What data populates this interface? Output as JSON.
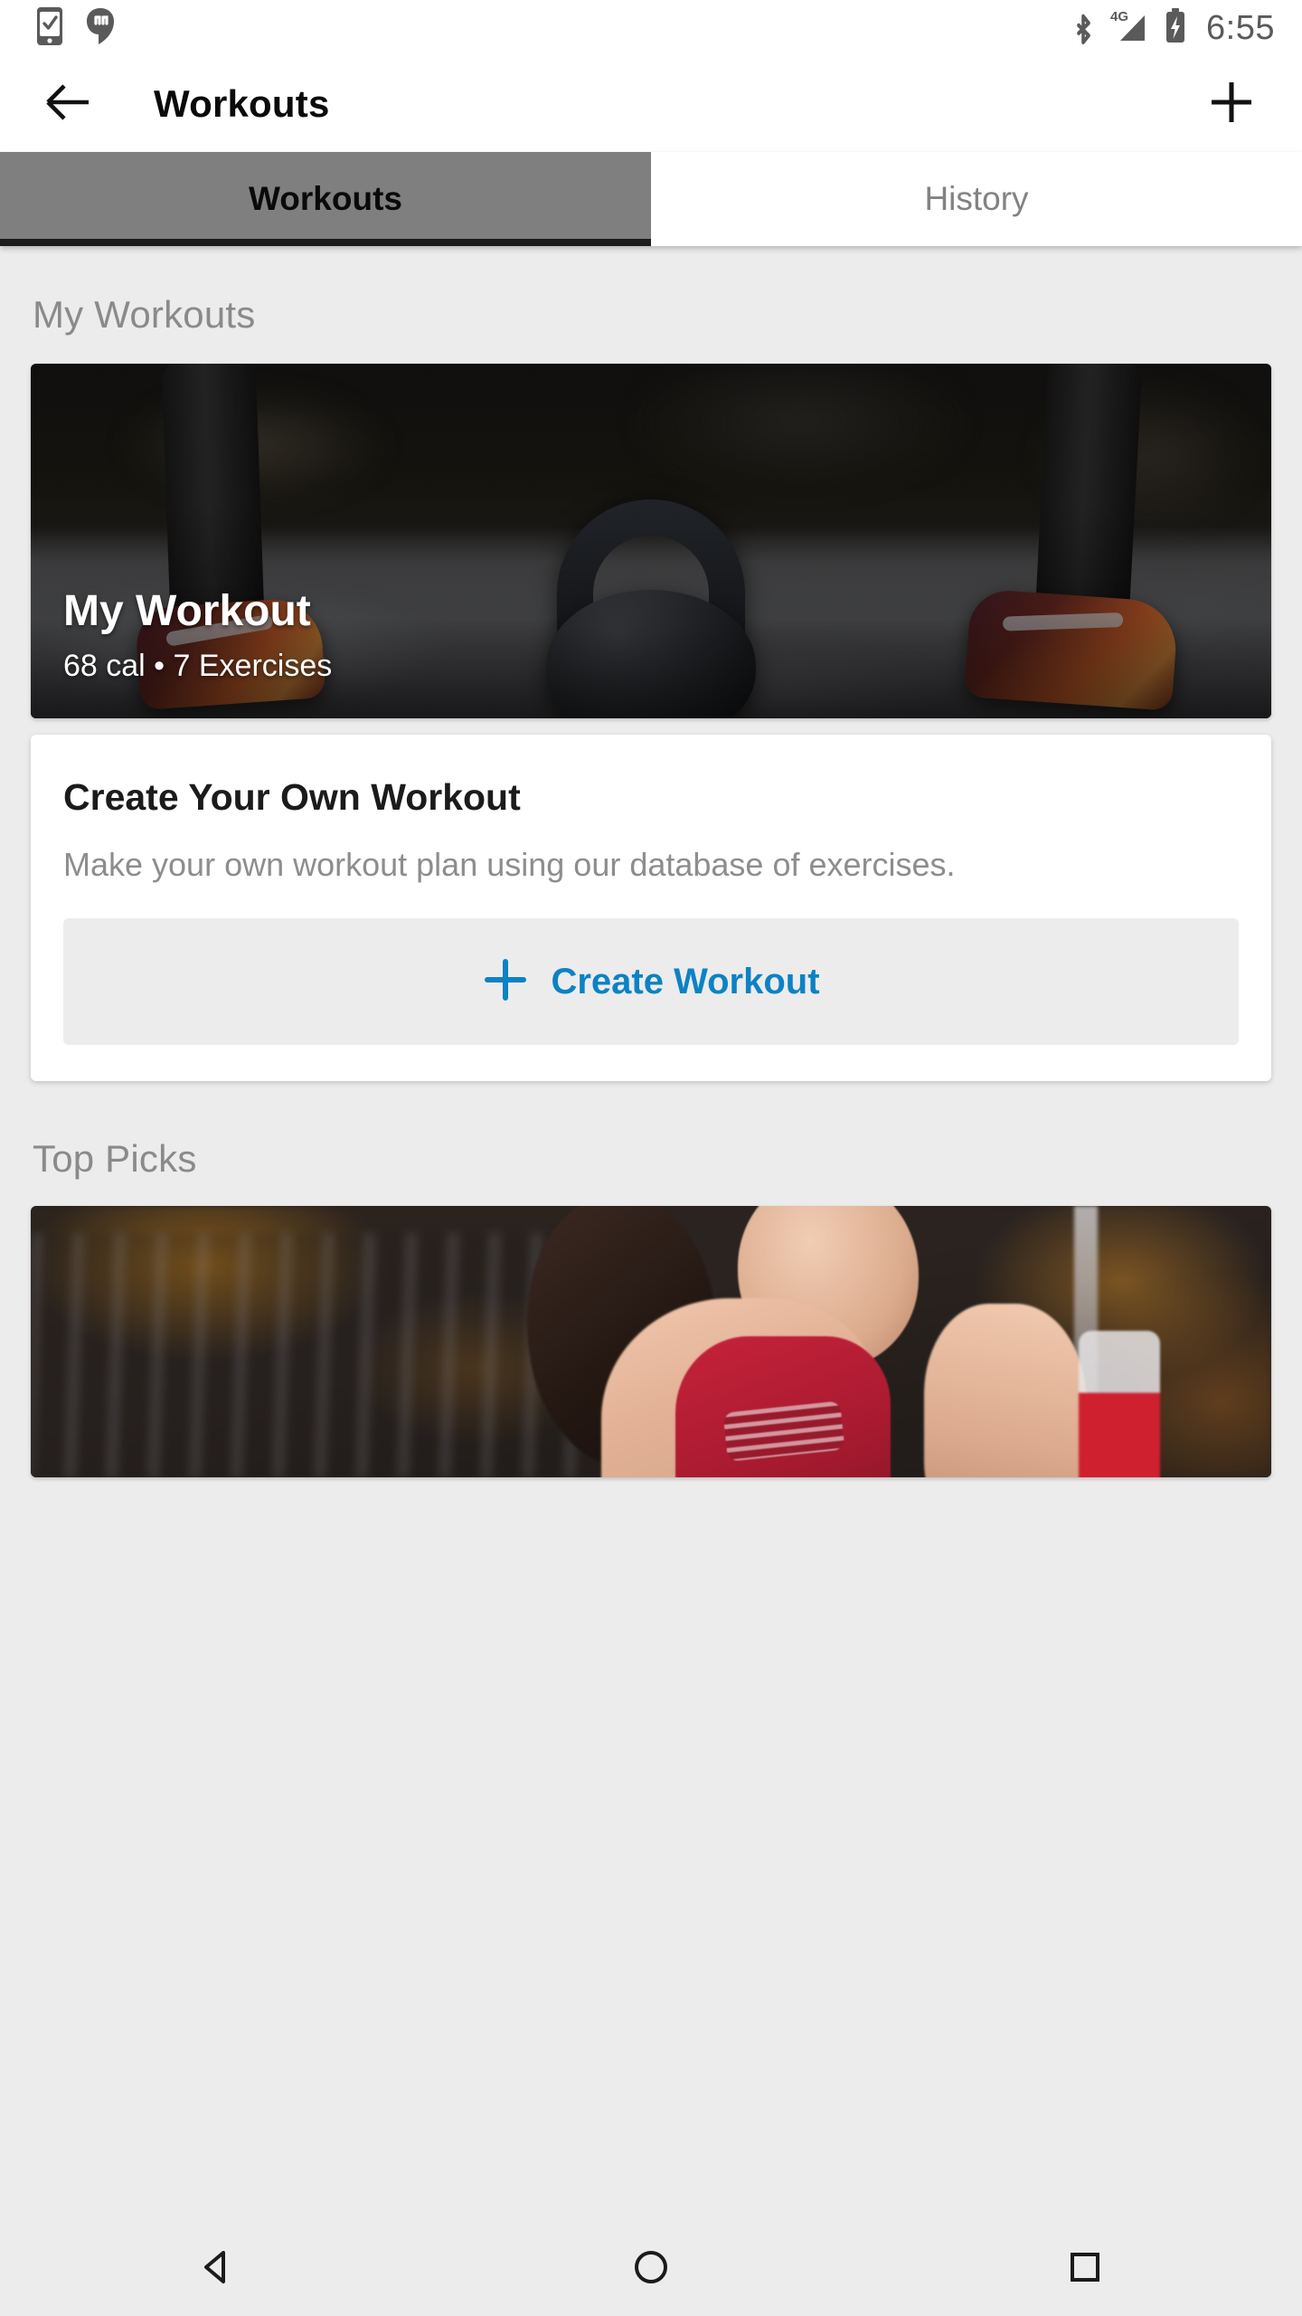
{
  "status_bar": {
    "time": "6:55",
    "left_icons": [
      {
        "name": "phone-check-icon"
      },
      {
        "name": "hangouts-chat-icon"
      }
    ],
    "right_icons": [
      {
        "name": "bluetooth-icon"
      },
      {
        "name": "signal-4g-icon",
        "label": "4G"
      },
      {
        "name": "battery-charging-icon"
      }
    ]
  },
  "app_bar": {
    "back_label": "back-arrow",
    "title": "Workouts",
    "add_label": "add"
  },
  "tabs": [
    {
      "label": "Workouts",
      "active": true
    },
    {
      "label": "History",
      "active": false
    }
  ],
  "sections": {
    "my_workouts": {
      "title": "My Workouts",
      "hero_card": {
        "title": "My Workout",
        "subtitle": "68 cal • 7 Exercises",
        "calories": "68 cal",
        "exercises": "7 Exercises",
        "image_alt": "kettlebell-on-gym-floor-photo"
      },
      "create_card": {
        "title": "Create Your Own Workout",
        "description": "Make your own workout plan using our database of exercises.",
        "button_label": "Create Workout",
        "button_icon": "plus-icon"
      }
    },
    "top_picks": {
      "title": "Top Picks",
      "card": {
        "image_alt": "woman-running-on-treadmill-photo"
      }
    }
  },
  "nav_bar": {
    "back": "back-triangle",
    "home": "home-circle",
    "recents": "recents-square"
  },
  "colors": {
    "accent_blue": "#0c82c4",
    "page_background": "#ececec",
    "card_background": "#ffffff",
    "active_tab_background": "#7f7f7f",
    "tab_indicator": "#1c1c1c",
    "muted_text": "#8a8a8a",
    "title_text": "#1b1b1b"
  }
}
